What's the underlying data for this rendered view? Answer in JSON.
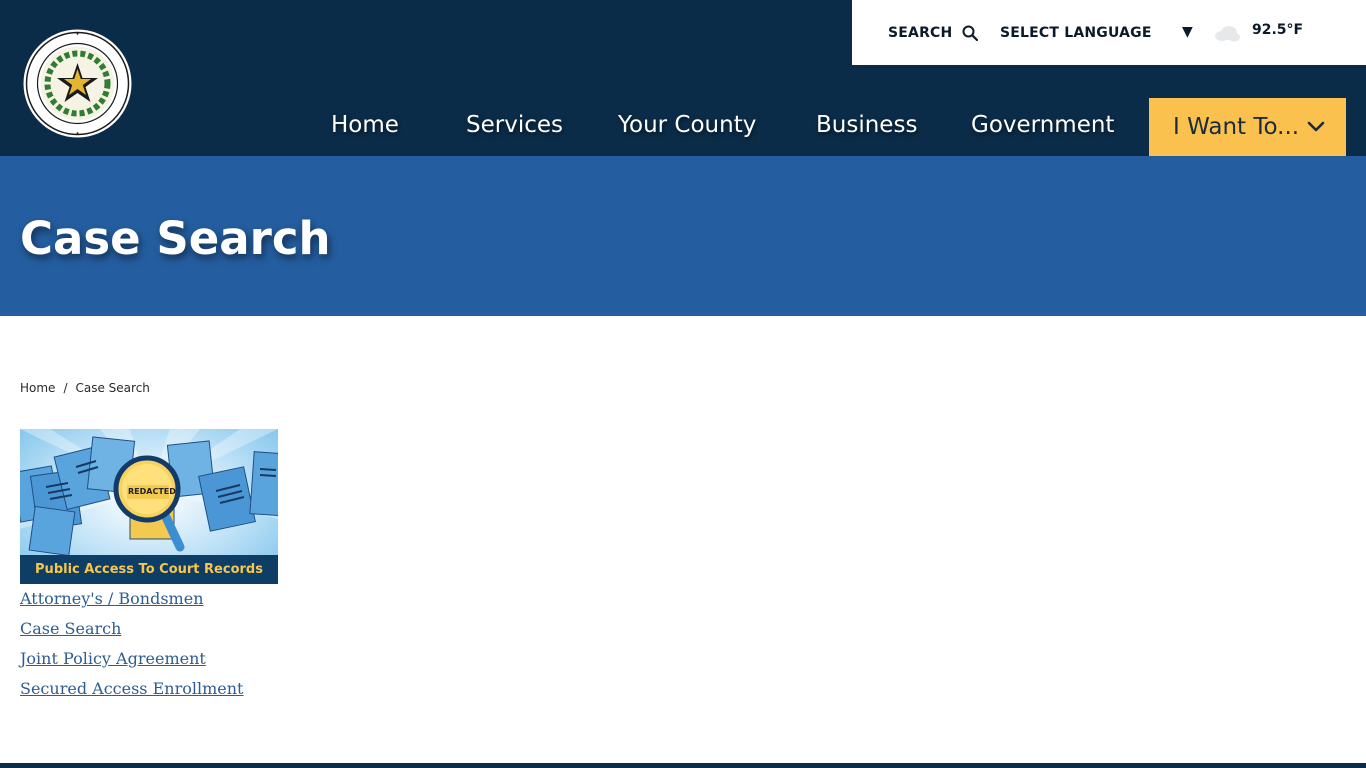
{
  "colors": {
    "header_bg": "#0b2c48",
    "banner_bg": "#245ea0",
    "accent_yellow": "#fbc14f",
    "link": "#2d5d8f"
  },
  "seal": {
    "ring_text": "THE STATE OF TEXAS · FORT BEND COUNTY"
  },
  "utility": {
    "search_label": "SEARCH",
    "search_icon": "search-icon",
    "language_label": "SELECT LANGUAGE",
    "language_caret": "▼",
    "weather_icon": "cloud-icon",
    "temperature": "92.5°F"
  },
  "nav": {
    "items": [
      {
        "label": "Home"
      },
      {
        "label": "Services"
      },
      {
        "label": "Your County"
      },
      {
        "label": "Business"
      },
      {
        "label": "Government"
      }
    ],
    "want_to": {
      "label": "I Want To...",
      "icon": "chevron-down-icon"
    }
  },
  "banner": {
    "title": "Case Search"
  },
  "breadcrumb": {
    "home": "Home",
    "separator": "/",
    "current": "Case Search"
  },
  "promo": {
    "stamp": "REDACTED",
    "caption": "Public Access To Court Records"
  },
  "links": [
    {
      "label": "Attorney's / Bondsmen"
    },
    {
      "label": "Case Search"
    },
    {
      "label": "Joint Policy Agreement"
    },
    {
      "label": "Secured Access Enrollment"
    }
  ]
}
